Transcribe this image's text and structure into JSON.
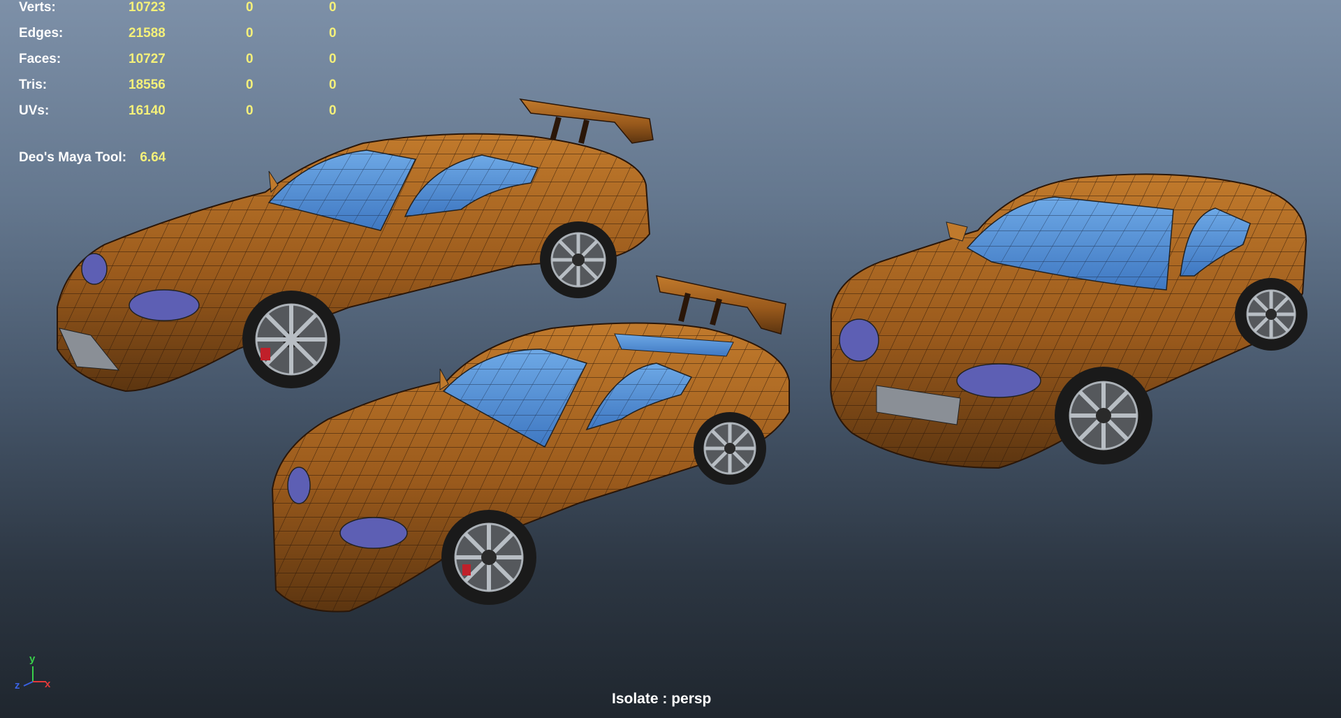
{
  "stats": {
    "rows": [
      {
        "label": "Verts:",
        "values": [
          "10723",
          "0",
          "0"
        ]
      },
      {
        "label": "Edges:",
        "values": [
          "21588",
          "0",
          "0"
        ]
      },
      {
        "label": "Faces:",
        "values": [
          "10727",
          "0",
          "0"
        ]
      },
      {
        "label": "Tris:",
        "values": [
          "18556",
          "0",
          "0"
        ]
      },
      {
        "label": "UVs:",
        "values": [
          "16140",
          "0",
          "0"
        ]
      }
    ]
  },
  "tool": {
    "label": "Deo's Maya Tool:",
    "value": "6.64"
  },
  "axis": {
    "y": "y",
    "x": "x",
    "z": "z"
  },
  "footer": {
    "isolate_text": "Isolate : persp"
  },
  "colors": {
    "body": "#9a5a1c",
    "glass": "#4f8fd6",
    "headlight": "#5d5fb4",
    "tire": "#1a1a1a",
    "rim": "#8a8f96",
    "stats_value": "#f4f07a"
  }
}
